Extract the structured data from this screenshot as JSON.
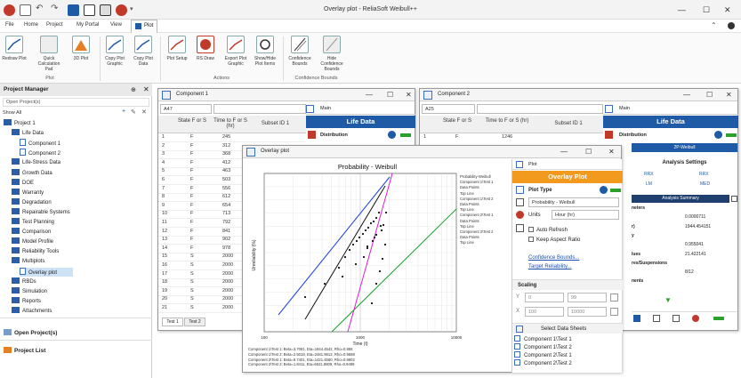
{
  "window": {
    "title": "Overlay plot - ReliaSoft Weibull++"
  },
  "menu": [
    "File",
    "Home",
    "Project",
    "My Portal",
    "View",
    "Plot"
  ],
  "ribbon": {
    "buttons": [
      {
        "label": "Redraw Plot"
      },
      {
        "label": "Quick Calculation Pad"
      },
      {
        "label": "3D Plot"
      },
      {
        "label": "Copy Plot Graphic"
      },
      {
        "label": "Copy Plot Data"
      },
      {
        "label": "Plot Setup"
      },
      {
        "label": "RS Draw"
      },
      {
        "label": "Export Plot Graphic"
      },
      {
        "label": "Show/Hide Plot Items"
      },
      {
        "label": "Confidence Bounds"
      },
      {
        "label": "Hide Confidence Bounds"
      }
    ],
    "groups": {
      "plot": "Plot",
      "actions": "Actions",
      "bounds": "Confidence Bounds"
    }
  },
  "project_manager": {
    "title": "Project Manager",
    "open_projects": "Open Project(s)",
    "show": "Show All",
    "tree": [
      {
        "label": "Project 1",
        "level": 0
      },
      {
        "label": "Life Data",
        "level": 1
      },
      {
        "label": "Component 1",
        "level": 2
      },
      {
        "label": "Component 2",
        "level": 2
      },
      {
        "label": "Life-Stress Data",
        "level": 1
      },
      {
        "label": "Growth Data",
        "level": 1
      },
      {
        "label": "DOE",
        "level": 1
      },
      {
        "label": "Warranty",
        "level": 1
      },
      {
        "label": "Degradation",
        "level": 1
      },
      {
        "label": "Repairable Systems",
        "level": 1
      },
      {
        "label": "Test Planning",
        "level": 1
      },
      {
        "label": "Comparison",
        "level": 1
      },
      {
        "label": "Model Profile",
        "level": 1
      },
      {
        "label": "Reliability Tools",
        "level": 1
      },
      {
        "label": "Multiplots",
        "level": 1
      },
      {
        "label": "Overlay plot",
        "level": 2
      },
      {
        "label": "RBDs",
        "level": 1
      },
      {
        "label": "Simulation",
        "level": 1
      },
      {
        "label": "Reports",
        "level": 1
      },
      {
        "label": "Attachments",
        "level": 1
      }
    ],
    "bottom": [
      "Open Project(s)",
      "Project List"
    ]
  },
  "component1": {
    "title": "Component 1",
    "cell_ref": "A47",
    "headers": [
      "State F or S",
      "Time to F or S (hr)",
      "Subset ID 1"
    ],
    "rows": [
      [
        "1",
        "F",
        "245"
      ],
      [
        "2",
        "F",
        "312"
      ],
      [
        "3",
        "F",
        "368"
      ],
      [
        "4",
        "F",
        "412"
      ],
      [
        "5",
        "F",
        "463"
      ],
      [
        "6",
        "F",
        "503"
      ],
      [
        "7",
        "F",
        "556"
      ],
      [
        "8",
        "F",
        "612"
      ],
      [
        "9",
        "F",
        "654"
      ],
      [
        "10",
        "F",
        "713"
      ],
      [
        "11",
        "F",
        "792"
      ],
      [
        "12",
        "F",
        "841"
      ],
      [
        "13",
        "F",
        "902"
      ],
      [
        "14",
        "F",
        "978"
      ],
      [
        "15",
        "S",
        "2000"
      ],
      [
        "16",
        "S",
        "2000"
      ],
      [
        "17",
        "S",
        "2000"
      ],
      [
        "18",
        "S",
        "2000"
      ],
      [
        "19",
        "S",
        "2000"
      ],
      [
        "20",
        "S",
        "2000"
      ],
      [
        "21",
        "S",
        "2000"
      ]
    ],
    "tabs": [
      "Test 1",
      "Test 2"
    ],
    "side_title": "Life Data",
    "side_label": "Main",
    "side_distribution": "Distribution"
  },
  "component2": {
    "title": "Component 2",
    "cell_ref": "A25",
    "headers": [
      "State F or S",
      "Time to F or S (hr)",
      "Subset ID 1"
    ],
    "first_row": [
      "1",
      "F",
      "1246"
    ],
    "side_title": "Life Data",
    "side_label": "Main",
    "side_distribution": "Distribution",
    "dist_value": "2P-Weibull",
    "analysis_settings": "Analysis Settings",
    "settings_row1": [
      "RRX",
      "RRX"
    ],
    "settings_row2": [
      "LM",
      "MED"
    ],
    "analysis_summary": "Analysis Summary",
    "summary": [
      {
        "label": "neters",
        "value": ""
      },
      {
        "label": "",
        "value": "0.0000711"
      },
      {
        "label": "r)",
        "value": "1944.454151"
      },
      {
        "label": "y",
        "value": ""
      },
      {
        "label": "",
        "value": "0.955041"
      },
      {
        "label": "lues",
        "value": "21.422141"
      },
      {
        "label": "res/Suspensions",
        "value": ""
      },
      {
        "label": "",
        "value": "8/12"
      },
      {
        "label": "nents",
        "value": ""
      }
    ]
  },
  "overlay": {
    "title": "Overlay plot",
    "plot_title": "Probability - Weibull",
    "ylabel": "Unreliability (%)",
    "xlabel": "Time (t)",
    "xticks": [
      "100",
      "1000",
      "10000"
    ],
    "legend": [
      "Probability-Weibull",
      "Component 1\\Test 1",
      "Data Points",
      "Top Line",
      "Component 1\\Test 2",
      "Data Points",
      "Top Line",
      "Component 2\\Test 1",
      "Data Points",
      "Top Line",
      "Component 2\\Test 2",
      "Data Points",
      "Top Line"
    ],
    "footer": [
      "Component 1\\Test 1: Beta=3.7081, Eta=1944.4542, Rho=0.955",
      "Component 1\\Test 2: Beta=2.5018, Eta=2481.9812, Rho=0.9588",
      "Component 2\\Test 1: Beta=9.7401, Eta=1421.4580, Rho=0.9802",
      "Component 2\\Test 2: Beta=1.8411, Eta=6521.8809, Rho=0.9489"
    ],
    "side": {
      "tab": "Plot",
      "title": "Overlay Plot",
      "plot_type_label": "Plot Type",
      "plot_type": "Probability - Weibull",
      "units_label": "Units",
      "units": "Hour (hr)",
      "checks": [
        "Auto Refresh",
        "Keep Aspect Ratio"
      ],
      "links": [
        "Confidence Bounds...",
        "Target Reliability..."
      ],
      "scaling": "Scaling",
      "y_min": "0",
      "y_max": "99",
      "x_min": "100",
      "x_max": "10000",
      "select_sheets": "Select Data Sheets",
      "sheets": [
        "Component 1\\Test 1",
        "Component 1\\Test 2",
        "Component 2\\Test 1",
        "Component 2\\Test 2"
      ]
    }
  },
  "colors": {
    "accent_blue": "#1f5aa6",
    "overlay_orange": "#f29a1e",
    "line_blue": "#1e3fd8",
    "line_green": "#17a22c",
    "line_magenta": "#e01dd0",
    "line_black": "#111111"
  }
}
